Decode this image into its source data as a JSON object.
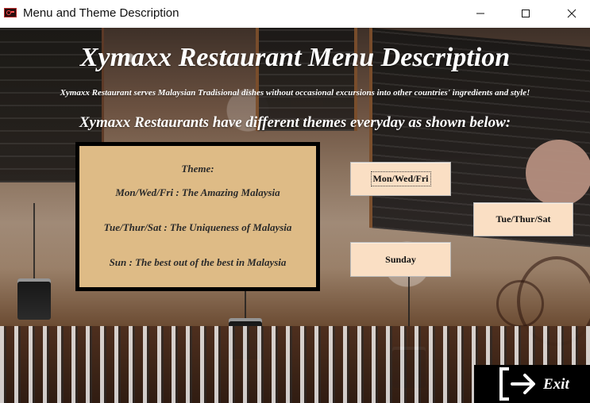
{
  "window": {
    "title": "Menu and Theme Description"
  },
  "header": {
    "title": "Xymaxx Restaurant Menu Description",
    "subtitle": "Xymaxx Restaurant serves Malaysian Tradisional dishes without occasional excursions into other countries' ingredients and style!",
    "themes_intro": "Xymaxx Restaurants have different themes everyday as shown below:"
  },
  "theme_panel": {
    "heading": "Theme:",
    "lines": [
      "Mon/Wed/Fri : The Amazing Malaysia",
      "Tue/Thur/Sat : The Uniqueness of Malaysia",
      "Sun : The best out of the best in Malaysia"
    ]
  },
  "buttons": {
    "mon_wed_fri": "Mon/Wed/Fri",
    "tue_thur_sat": "Tue/Thur/Sat",
    "sunday": "Sunday",
    "exit": "Exit"
  },
  "icons": {
    "app": "app-icon",
    "minimize": "minimize-icon",
    "maximize": "maximize-icon",
    "close": "close-icon",
    "exit": "exit-arrow-icon"
  },
  "colors": {
    "theme_panel_bg": "#debb86",
    "day_button_bg": "#fadfc4",
    "exit_button_bg": "#000000",
    "title_text": "#ffffff"
  }
}
